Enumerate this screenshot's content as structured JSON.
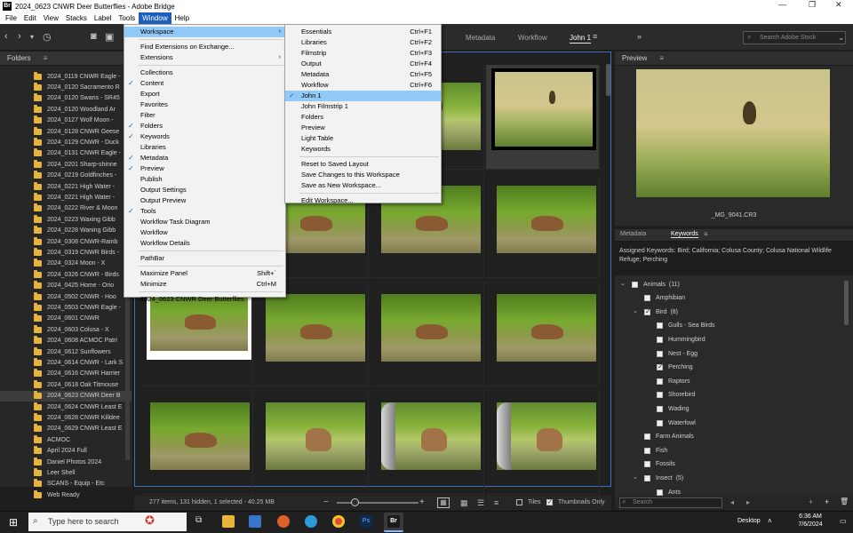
{
  "window": {
    "title": "2024_0623 CNWR Deer Butterflies - Adobe Bridge",
    "app_icon": "Br"
  },
  "menubar": [
    "File",
    "Edit",
    "View",
    "Stacks",
    "Label",
    "Tools",
    "Window",
    "Help"
  ],
  "workspace_tabs": [
    "Metadata",
    "Workflow",
    "John 1"
  ],
  "stock_search_placeholder": "Search Adobe Stock",
  "folders_panel": {
    "title": "Folders",
    "items": [
      "2024_0119 CNWR Eagle -",
      "2024_0120 Sacramento R",
      "2024_0120 Swans - SR45",
      "2024_0120 Woodland Ar",
      "2024_0127 Wolf Moon -",
      "2024_0128 CNWR Geese",
      "2024_0129 CNWR - Duck",
      "2024_0131 CNWR Eagle -",
      "2024_0201 Sharp-shinne",
      "2024_0219 Goldfinches -",
      "2024_0221 High Water -",
      "2024_0221 High Water -",
      "2024_0222 River & Moon",
      "2024_0223 Waxing Gibb",
      "2024_0228 Waning Gibb",
      "2024_0308 CNWR-Rainb",
      "2024_0319 CNWR Birds -",
      "2024_0324 Moon - X",
      "2024_0326 CNWR - Birds",
      "2024_0425 Home - Orio",
      "2024_0502 CNWR - Hoo",
      "2024_0503 CNWR Eagle -",
      "2024_0601 CNWR",
      "2024_0603 Colusa - X",
      "2024_0608 ACMOC Patri",
      "2024_0612 Sunflowers",
      "2024_0614 CNWR - Lark S",
      "2024_0616 CNWR Harrier",
      "2024_0618 Oak Titmouse",
      "2024_0623 CNWR Deer B",
      "2024_0624 CNWR Least E",
      "2024_0628 CNWR Killdee",
      "2024_0629 CNWR Least E",
      "ACMOC",
      "April 2024 Full",
      "Daniel Photos 2024",
      "Leer Shell",
      "SCANS - Equip - Etc",
      "Web Ready"
    ]
  },
  "window_menu": {
    "items": [
      {
        "label": "Workspace",
        "arrow": true,
        "highlight": true
      },
      {
        "sep": true
      },
      {
        "label": "Find Extensions on Exchange..."
      },
      {
        "label": "Extensions",
        "arrow": true
      },
      {
        "sep": true
      },
      {
        "label": "Collections"
      },
      {
        "label": "Content",
        "checked": true
      },
      {
        "label": "Export"
      },
      {
        "label": "Favorites"
      },
      {
        "label": "Filter"
      },
      {
        "label": "Folders",
        "checked": true
      },
      {
        "label": "Keywords",
        "checked": true
      },
      {
        "label": "Libraries"
      },
      {
        "label": "Metadata",
        "checked": true
      },
      {
        "label": "Preview",
        "checked": true
      },
      {
        "label": "Publish"
      },
      {
        "label": "Output Settings"
      },
      {
        "label": "Output Preview"
      },
      {
        "label": "Tools",
        "checked": true
      },
      {
        "label": "Workflow Task Diagram"
      },
      {
        "label": "Workflow"
      },
      {
        "label": "Workflow Details"
      },
      {
        "sep": true
      },
      {
        "label": "PathBar"
      },
      {
        "sep": true
      },
      {
        "label": "Maximize Panel",
        "shortcut": "Shift+`"
      },
      {
        "label": "Minimize",
        "shortcut": "Ctrl+M"
      },
      {
        "sep": true
      },
      {
        "label": "2024_0623 CNWR Deer Butterflies"
      }
    ]
  },
  "workspace_menu": {
    "items": [
      {
        "label": "Essentials",
        "shortcut": "Ctrl+F1"
      },
      {
        "label": "Libraries",
        "shortcut": "Ctrl+F2"
      },
      {
        "label": "Filmstrip",
        "shortcut": "Ctrl+F3"
      },
      {
        "label": "Output",
        "shortcut": "Ctrl+F4"
      },
      {
        "label": "Metadata",
        "shortcut": "Ctrl+F5"
      },
      {
        "label": "Workflow",
        "shortcut": "Ctrl+F6"
      },
      {
        "label": "John 1",
        "checked": true,
        "highlight": true
      },
      {
        "label": "John Filmstrip 1"
      },
      {
        "label": "Folders"
      },
      {
        "label": "Preview"
      },
      {
        "label": "Light Table"
      },
      {
        "label": "Keywords"
      },
      {
        "sep": true
      },
      {
        "label": "Reset to Saved Layout"
      },
      {
        "label": "Save Changes to this Workspace"
      },
      {
        "label": "Save as New Workspace..."
      },
      {
        "sep": true
      },
      {
        "label": "Edit Workspace..."
      }
    ]
  },
  "status_bar": "277 items, 131 hidden, 1 selected - 40.25 MB",
  "view_options": {
    "tiles": "Tiles",
    "thumbnails_only": "Thumbnails Only"
  },
  "preview_panel": {
    "title": "Preview",
    "filename": "_MG_9041.CR3"
  },
  "keyword_tabs": [
    "Metadata",
    "Keywords"
  ],
  "assigned_keywords": "Assigned Keywords: Bird; California; Colusa County; Colusa National Wildlife Refuge; Perching",
  "keywords": [
    {
      "label": "Animals",
      "count": "(11)",
      "level": 0,
      "expanded": true,
      "checked": false
    },
    {
      "label": "Amphibian",
      "level": 1,
      "checked": false
    },
    {
      "label": "Bird",
      "count": "(8)",
      "level": 1,
      "expanded": true,
      "checked": true
    },
    {
      "label": "Gulls - Sea Birds",
      "level": 2,
      "checked": false
    },
    {
      "label": "Hummingbird",
      "level": 2,
      "checked": false
    },
    {
      "label": "Nest - Egg",
      "level": 2,
      "checked": false
    },
    {
      "label": "Perching",
      "level": 2,
      "checked": true
    },
    {
      "label": "Raptors",
      "level": 2,
      "checked": false
    },
    {
      "label": "Shorebird",
      "level": 2,
      "checked": false
    },
    {
      "label": "Wading",
      "level": 2,
      "checked": false
    },
    {
      "label": "Waterfowl",
      "level": 2,
      "checked": false
    },
    {
      "label": "Farm Animals",
      "level": 1,
      "checked": false
    },
    {
      "label": "Fish",
      "level": 1,
      "checked": false
    },
    {
      "label": "Fossils",
      "level": 1,
      "checked": false
    },
    {
      "label": "Insect",
      "count": "(5)",
      "level": 1,
      "expanded": true,
      "checked": false
    },
    {
      "label": "Ants",
      "level": 2,
      "checked": false
    }
  ],
  "keyword_search_placeholder": "Search",
  "taskbar": {
    "search_placeholder": "Type here to search",
    "desktop_label": "Desktop",
    "time": "6:36 AM",
    "date": "7/6/2024"
  }
}
